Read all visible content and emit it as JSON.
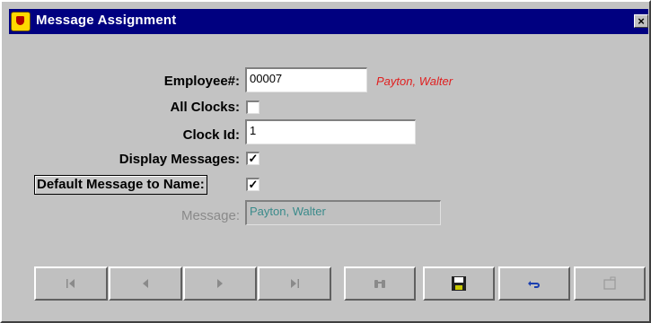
{
  "window": {
    "title": "Message Assignment",
    "close_label": "×"
  },
  "form": {
    "employee_label": "Employee#:",
    "employee_value": "00007",
    "employee_name": "Payton, Walter",
    "all_clocks_label": "All Clocks:",
    "all_clocks_checked": false,
    "clock_id_label": "Clock Id:",
    "clock_id_value": "1",
    "display_messages_label": "Display Messages:",
    "display_messages_checked": true,
    "default_message_label": "Default Message to Name:",
    "default_message_checked": true,
    "message_label": "Message:",
    "message_value": "Payton, Walter"
  },
  "toolbar": {
    "buttons": [
      {
        "icon": "first-record-icon"
      },
      {
        "icon": "previous-record-icon"
      },
      {
        "icon": "next-record-icon"
      },
      {
        "icon": "last-record-icon"
      },
      {
        "icon": "binoculars-icon"
      },
      {
        "icon": "save-icon"
      },
      {
        "icon": "undo-icon"
      },
      {
        "icon": "delete-icon"
      }
    ]
  },
  "colors": {
    "titlebar": "#000080",
    "window": "#c3c3c3",
    "employee_name": "#e02020",
    "disabled_text": "#3a8a8a"
  }
}
